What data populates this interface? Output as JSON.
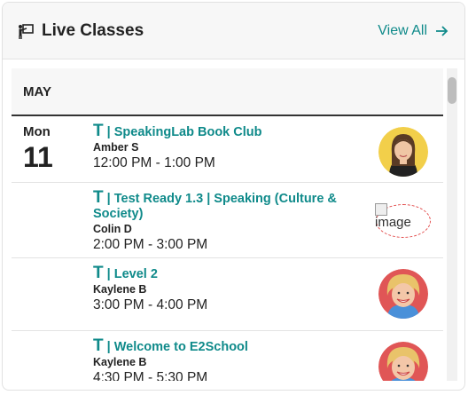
{
  "header": {
    "title": "Live Classes",
    "view_all": "View All",
    "icon": "teacher-board-icon",
    "accent": "#0f8a8a"
  },
  "month": "MAY",
  "date": {
    "dow": "Mon",
    "day": "11"
  },
  "classes": [
    {
      "prefix": "T",
      "title": " | SpeakingLab Book Club",
      "teacher": "Amber S",
      "time": "12:00 PM - 1:00 PM",
      "avatar": "female-teacher-avatar"
    },
    {
      "prefix": "T",
      "title": " | Test Ready 1.3 | Speaking (Culture & Society)",
      "teacher": "Colin D",
      "time": "2:00 PM - 3:00 PM",
      "avatar_alt": "image"
    },
    {
      "prefix": "T",
      "title": " | Level 2",
      "teacher": "Kaylene B",
      "time": "3:00 PM - 4:00 PM",
      "avatar": "blonde-teacher-avatar"
    },
    {
      "prefix": "T",
      "title": " | Welcome to E2School",
      "teacher": "Kaylene B",
      "time": "4:30 PM - 5:30 PM",
      "avatar": "blonde-teacher-avatar"
    }
  ]
}
